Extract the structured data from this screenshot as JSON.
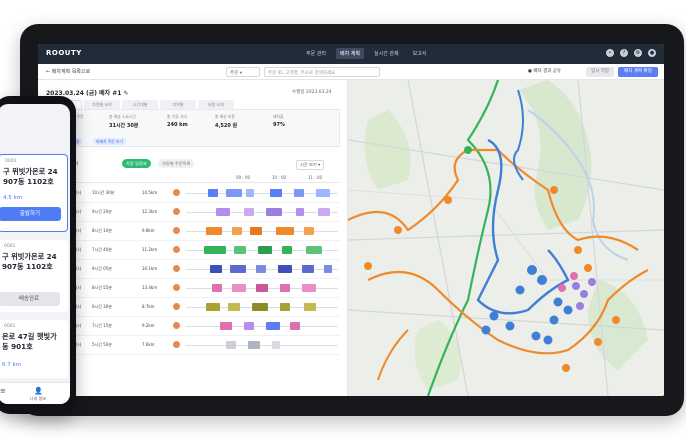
{
  "app": {
    "logo": "ROOUTY",
    "nav": [
      {
        "label": "주문 관리",
        "active": false
      },
      {
        "label": "배차 계획",
        "active": true
      },
      {
        "label": "실시간 관제",
        "active": false
      },
      {
        "label": "보고서",
        "active": false
      }
    ]
  },
  "toolbar": {
    "back_label": "← 배차계획 목록으로",
    "select_label": "주문 ▾",
    "search_placeholder": "주문 ID, 고객명, 주소로 검색하세요",
    "toggle_label": "● 배차 결과 공유",
    "gray_button": "임시 저장",
    "blue_button": "배차 계획 확정"
  },
  "route": {
    "title": "2023.03.24 (금) 배차 #1 ✎",
    "date": "수행일 2023.03.24",
    "summary_tabs": [
      "배차 요약",
      "차량별 요약",
      "시간대별",
      "지역별",
      "비용 요약"
    ],
    "stats": [
      {
        "label": "총 배차 차량 / 주문",
        "value": "10 / 64"
      },
      {
        "label": "총 배송 소요시간",
        "value": "31시간 30분"
      },
      {
        "label": "총 이동 거리",
        "value": "240 km"
      },
      {
        "label": "총 배송 비용",
        "value": "4,520 원"
      },
      {
        "label": "배차율",
        "value": "97%"
      }
    ],
    "chips": [
      "차량 추가 배정",
      "미배차 주문 보기"
    ],
    "filter_label": "보기 단위",
    "filter_active": "차량 일정표",
    "filter_inactive": "차량별 주문목록",
    "filter_right": "시간 보기 ▾",
    "timeline_times": [
      "09 : 00",
      "10 : 00",
      "11 : 00"
    ],
    "rows": [
      {
        "vehicle": "1톤 탑차",
        "driver": "김기사",
        "time": "10시간 30분",
        "distance": "10.5km"
      },
      {
        "vehicle": "1톤 탑차",
        "driver": "이기사",
        "time": "9시간 20분",
        "distance": "12.3km"
      },
      {
        "vehicle": "1톤 탑차",
        "driver": "박기사",
        "time": "8시간 10분",
        "distance": "9.8km"
      },
      {
        "vehicle": "1톤 탑차",
        "driver": "최기사",
        "time": "7시간 40분",
        "distance": "11.2km"
      },
      {
        "vehicle": "1톤 탑차",
        "driver": "정기사",
        "time": "9시간 05분",
        "distance": "10.1km"
      },
      {
        "vehicle": "1톤 탑차",
        "driver": "강기사",
        "time": "8시간 55분",
        "distance": "13.4km"
      },
      {
        "vehicle": "1톤 탑차",
        "driver": "조기사",
        "time": "6시간 30분",
        "distance": "8.7km"
      },
      {
        "vehicle": "1톤 탑차",
        "driver": "윤기사",
        "time": "7시간 15분",
        "distance": "9.2km"
      },
      {
        "vehicle": "1톤 탑차",
        "driver": "장기사",
        "time": "5시간 50분",
        "distance": "7.6km"
      }
    ]
  },
  "colors": {
    "blue_route": "#3f7fd6",
    "orange_route": "#ee8a2a",
    "green_route": "#34b45a",
    "accent": "#4f7cf5"
  },
  "phone": {
    "cards": [
      {
        "id": "0001",
        "address": "구 위빗가온로 24\n907동 1102호",
        "distance": "4.5 km",
        "button": "출발하기",
        "active": true
      },
      {
        "id": "0001",
        "address": "구 위빗가온로 24\n907동 1102호",
        "distance": "",
        "button": "배송완료",
        "active": false
      },
      {
        "id": "0001",
        "address": "온로 47길 햇빛가\n동 901호",
        "distance": "6.7 km",
        "button": "",
        "active": false
      }
    ],
    "nav": [
      {
        "icon": "≡",
        "label": ""
      },
      {
        "icon": "👤",
        "label": "나의 정보"
      }
    ]
  }
}
